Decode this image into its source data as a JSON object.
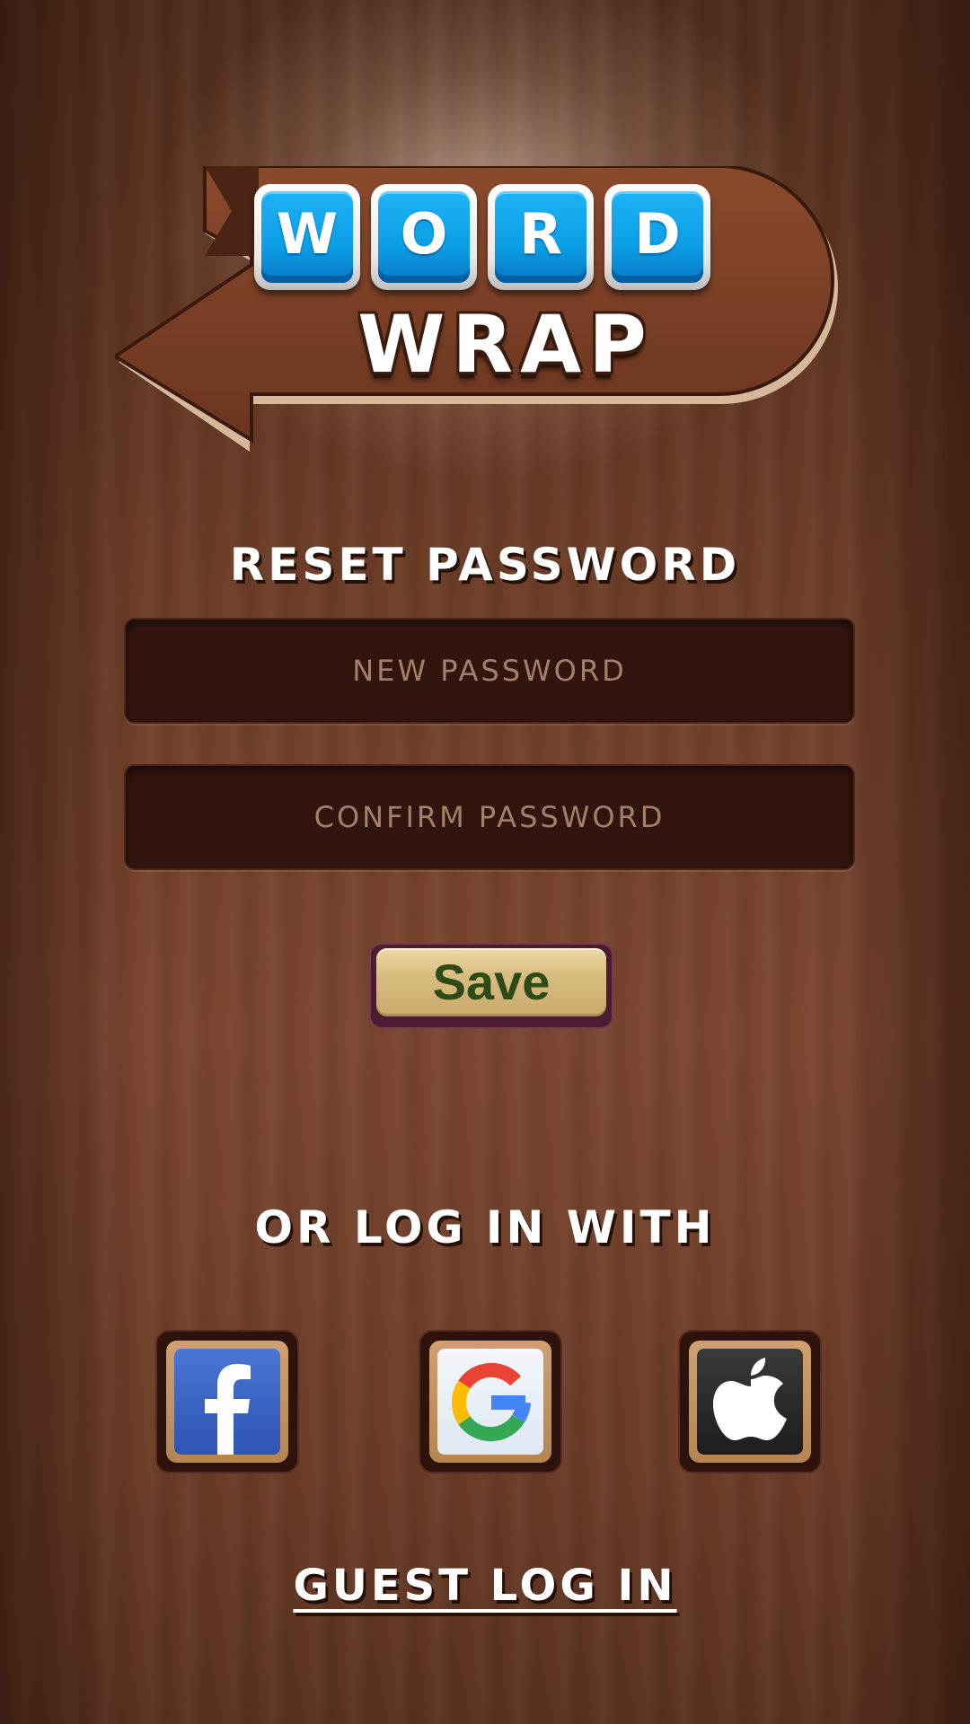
{
  "logo": {
    "tiles": [
      "W",
      "O",
      "R",
      "D"
    ],
    "subtitle": "WRAP"
  },
  "reset": {
    "title": "RESET PASSWORD",
    "new_password_placeholder": "NEW PASSWORD",
    "confirm_password_placeholder": "CONFIRM PASSWORD",
    "save_label": "Save"
  },
  "social": {
    "title": "OR LOG IN WITH",
    "providers": [
      {
        "name": "facebook",
        "icon": "facebook-icon",
        "color": "#3b62c4"
      },
      {
        "name": "google",
        "icon": "google-icon",
        "color": "#eef3f8"
      },
      {
        "name": "apple",
        "icon": "apple-icon",
        "color": "#2a2a2a"
      }
    ]
  },
  "guest": {
    "label": "GUEST LOG IN"
  },
  "colors": {
    "tile_blue": "#0b9ee6",
    "save_text": "#2c4b16",
    "save_button": "#d8bc7f",
    "field_bg": "#331510",
    "placeholder": "#a48069"
  }
}
